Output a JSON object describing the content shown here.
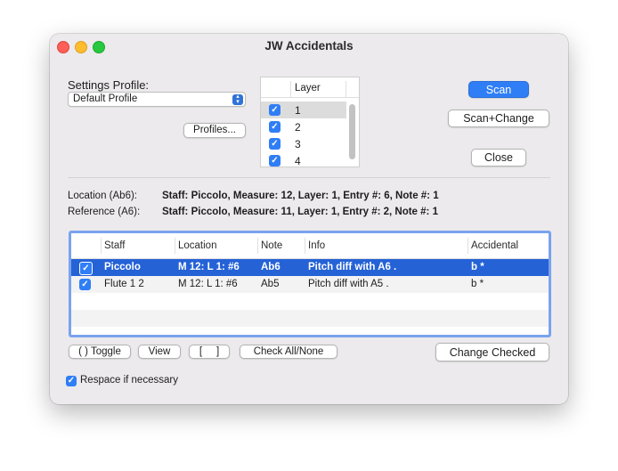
{
  "window": {
    "title": "JW Accidentals"
  },
  "settings": {
    "profile_label": "Settings Profile:",
    "profile_value": "Default Profile",
    "profiles_button": "Profiles..."
  },
  "layers": {
    "header": "Layer",
    "items": [
      {
        "label": "1",
        "checked": true
      },
      {
        "label": "2",
        "checked": true
      },
      {
        "label": "3",
        "checked": true
      },
      {
        "label": "4",
        "checked": true
      }
    ]
  },
  "actions": {
    "scan": "Scan",
    "scan_change": "Scan+Change",
    "close": "Close"
  },
  "info": {
    "location_label": "Location (Ab6):",
    "location_value": "Staff: Piccolo, Measure: 12, Layer: 1, Entry #: 6, Note #: 1",
    "reference_label": "Reference (A6):",
    "reference_value": "Staff: Piccolo, Measure: 11, Layer: 1, Entry #: 2, Note #: 1"
  },
  "table": {
    "columns": [
      "Staff",
      "Location",
      "Note",
      "Info",
      "Accidental"
    ],
    "rows": [
      {
        "checked": true,
        "staff": "Piccolo",
        "location": "M 12: L 1: #6",
        "note": "Ab6",
        "info": "Pitch diff with A6 .",
        "accidental": "b *"
      },
      {
        "checked": true,
        "staff": "Flute 1 2",
        "location": "M 12: L 1: #6",
        "note": "Ab5",
        "info": "Pitch diff with A5 .",
        "accidental": "b *"
      }
    ]
  },
  "bottom": {
    "toggle": "( ) Toggle",
    "view": "View",
    "bracket": "[     ]",
    "check_all": "Check All/None",
    "change_checked": "Change Checked",
    "respace_label": "Respace if necessary"
  },
  "colors": {
    "accent": "#2f7ef6",
    "selection": "#2462d6",
    "table_border": "#7aa3ef"
  }
}
